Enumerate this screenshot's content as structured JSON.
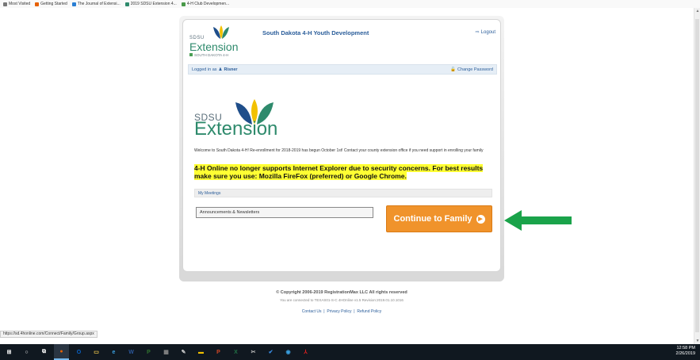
{
  "browser": {
    "bookmarks": [
      {
        "label": "Most Visited",
        "icon": "gear-icon",
        "color": "#777777"
      },
      {
        "label": "Getting Started",
        "icon": "firefox-icon",
        "color": "#e66000"
      },
      {
        "label": "The Journal of Extensi...",
        "icon": "journal-icon",
        "color": "#2a7fd4"
      },
      {
        "label": "2019 SDSU Extension 4...",
        "icon": "sdsu-icon",
        "color": "#2e8a6c"
      },
      {
        "label": "4-H Club Developmen...",
        "icon": "clover-icon",
        "color": "#4a9a4a"
      }
    ],
    "status_url": "https://sd.4honline.com/Connect/Family/Group.aspx"
  },
  "header": {
    "logo_sdsu": "SDSU",
    "logo_extension": "Extension",
    "logo_sub": "SOUTH DAKOTA 4-H",
    "title": "South Dakota 4-H Youth Development",
    "logout_label": "Logout"
  },
  "subbar": {
    "logged_in_prefix": "Logged in as",
    "user_name": "Risner",
    "change_password_label": "Change Password"
  },
  "main": {
    "logo_sdsu": "SDSU",
    "logo_extension": "Extension",
    "welcome_text": "Welcome to South Dakota 4-H! Re-enrollment for 2018-2019 has begun October 1st! Contact your county extension office if you need support in enrolling your family",
    "warning_text": "4-H Online no longer supports Internet Explorer due to security concerns.  For best results make sure you use:  Mozilla FireFox (preferred) or Google Chrome.",
    "meetings_label": "My Meetings",
    "announcements_label": "Announcements & Newsletters",
    "continue_label": "Continue to Family"
  },
  "footer": {
    "copyright": "© Copyright 2006-2019 RegistrationMax LLC All rights reserved",
    "connected": "You are connected to TEXAS01-S-C 4HOnline v1.5 Revision:2019.01.10.1016",
    "contact_label": "Contact Us",
    "privacy_label": "Privacy Policy",
    "refund_label": "Refund Policy",
    "separator": "|"
  },
  "colors": {
    "accent_green": "#1aa34a",
    "continue_orange": "#f0932b",
    "link_blue": "#2a5d9a",
    "highlight_yellow": "#ffff33"
  },
  "taskbar": {
    "items": [
      {
        "name": "windows-start-icon",
        "glyph": "⊞",
        "color": "#ffffff",
        "active": false
      },
      {
        "name": "search-icon",
        "glyph": "○",
        "color": "#ffffff",
        "active": false
      },
      {
        "name": "task-view-icon",
        "glyph": "⧉",
        "color": "#ffffff",
        "active": false
      },
      {
        "name": "firefox-icon",
        "glyph": "●",
        "color": "#e66000",
        "active": true
      },
      {
        "name": "outlook-icon",
        "glyph": "O",
        "color": "#0a64c8",
        "active": false
      },
      {
        "name": "file-explorer-icon",
        "glyph": "▭",
        "color": "#f2c94c",
        "active": false
      },
      {
        "name": "edge-icon",
        "glyph": "e",
        "color": "#3aa0e0",
        "active": false
      },
      {
        "name": "word-icon",
        "glyph": "W",
        "color": "#2b579a",
        "active": false
      },
      {
        "name": "project-icon",
        "glyph": "P",
        "color": "#31752f",
        "active": false
      },
      {
        "name": "calculator-icon",
        "glyph": "▦",
        "color": "#888888",
        "active": false
      },
      {
        "name": "paint-icon",
        "glyph": "✎",
        "color": "#cccccc",
        "active": false
      },
      {
        "name": "sticky-notes-icon",
        "glyph": "▬",
        "color": "#f2c100",
        "active": false
      },
      {
        "name": "powerpoint-icon",
        "glyph": "P",
        "color": "#d24726",
        "active": false
      },
      {
        "name": "excel-icon",
        "glyph": "X",
        "color": "#217346",
        "active": false
      },
      {
        "name": "snipping-tool-icon",
        "glyph": "✂",
        "color": "#bbbbbb",
        "active": false
      },
      {
        "name": "checkmark-app-icon",
        "glyph": "✔",
        "color": "#3a8ee6",
        "active": false
      },
      {
        "name": "chat-icon",
        "glyph": "◉",
        "color": "#3aa0e0",
        "active": false
      },
      {
        "name": "acrobat-icon",
        "glyph": "⅄",
        "color": "#e02020",
        "active": false
      }
    ],
    "time": "12:58 PM",
    "date": "2/26/2019"
  }
}
